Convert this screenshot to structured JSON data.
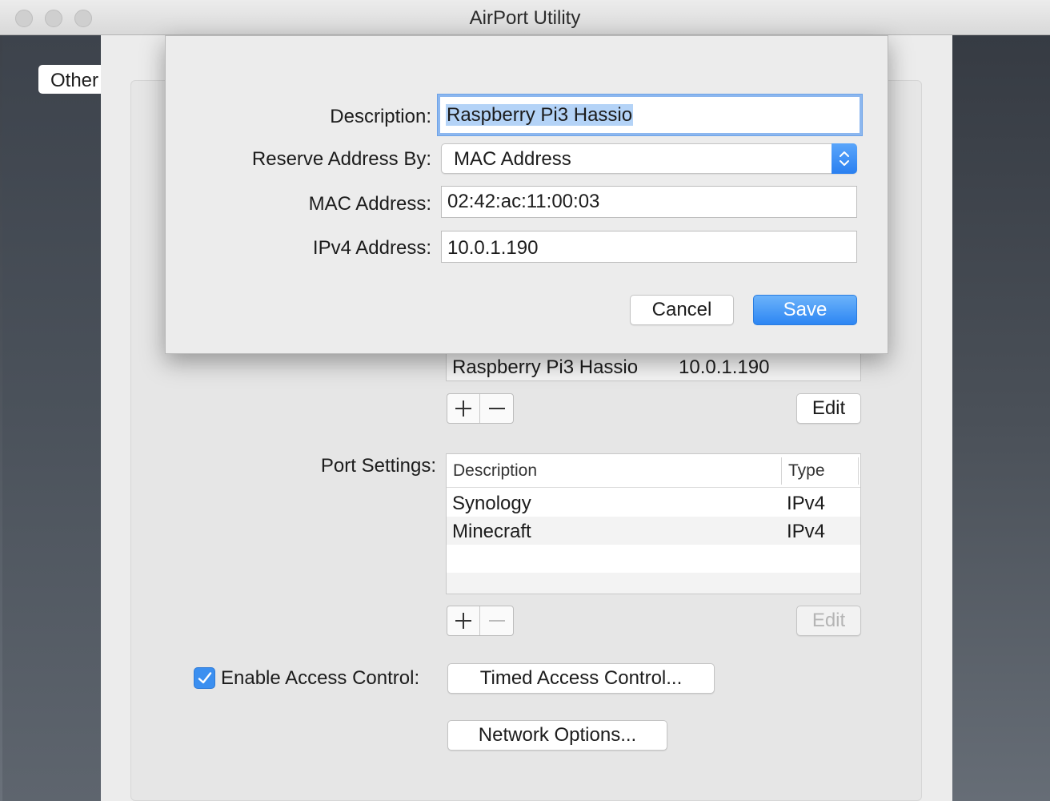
{
  "window": {
    "title": "AirPort Utility"
  },
  "background": {
    "other_button_label": "Other"
  },
  "dhcp_reservations": {
    "rows": [
      {
        "description": "Raspberry Pi3 Hassio",
        "address": "10.0.1.190"
      }
    ],
    "edit_label": "Edit"
  },
  "port_settings": {
    "label": "Port Settings:",
    "columns": [
      "Description",
      "Type"
    ],
    "rows": [
      {
        "description": "Synology",
        "type": "IPv4"
      },
      {
        "description": "Minecraft",
        "type": "IPv4"
      }
    ],
    "edit_label": "Edit"
  },
  "access_control": {
    "label": "Enable Access Control:",
    "checked": true,
    "timed_button": "Timed Access Control..."
  },
  "network_options_button": "Network Options...",
  "dialog": {
    "description_label": "Description:",
    "description_value": "Raspberry Pi3 Hassio",
    "reserve_by_label": "Reserve Address By:",
    "reserve_by_value": "MAC Address",
    "mac_label": "MAC Address:",
    "mac_value": "02:42:ac:11:00:03",
    "ipv4_label": "IPv4 Address:",
    "ipv4_value": "10.0.1.190",
    "cancel_label": "Cancel",
    "save_label": "Save"
  },
  "icons": {
    "plus": "plus-icon",
    "minus": "minus-icon",
    "checkmark": "checkmark-icon",
    "updown": "up-down-chevron-icon"
  },
  "colors": {
    "accent": "#2d86f3",
    "focus_ring": "#8cb7ef",
    "selection": "#b4d3f7"
  }
}
